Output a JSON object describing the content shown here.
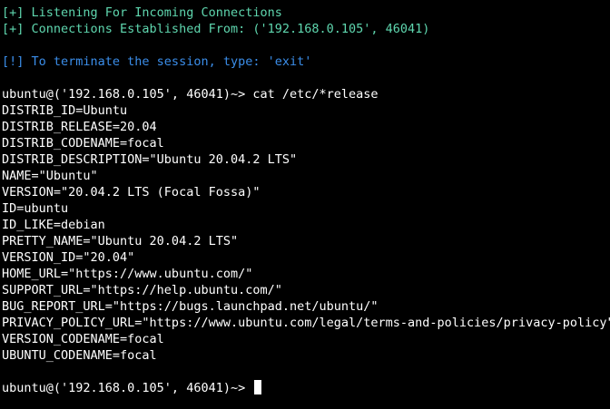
{
  "terminal": {
    "status_lines": [
      "[+] Listening For Incoming Connections",
      "[+] Connections Established From: ('192.168.0.105', 46041)"
    ],
    "info_line": "[!] To terminate the session, type: 'exit'",
    "prompt": "ubuntu@('192.168.0.105', 46041)~> ",
    "command": "cat /etc/*release",
    "output_lines": [
      "DISTRIB_ID=Ubuntu",
      "DISTRIB_RELEASE=20.04",
      "DISTRIB_CODENAME=focal",
      "DISTRIB_DESCRIPTION=\"Ubuntu 20.04.2 LTS\"",
      "NAME=\"Ubuntu\"",
      "VERSION=\"20.04.2 LTS (Focal Fossa)\"",
      "ID=ubuntu",
      "ID_LIKE=debian",
      "PRETTY_NAME=\"Ubuntu 20.04.2 LTS\"",
      "VERSION_ID=\"20.04\"",
      "HOME_URL=\"https://www.ubuntu.com/\"",
      "SUPPORT_URL=\"https://help.ubuntu.com/\"",
      "BUG_REPORT_URL=\"https://bugs.launchpad.net/ubuntu/\"",
      "PRIVACY_POLICY_URL=\"https://www.ubuntu.com/legal/terms-and-policies/privacy-policy\"",
      "VERSION_CODENAME=focal",
      "UBUNTU_CODENAME=focal"
    ],
    "current_prompt": "ubuntu@('192.168.0.105', 46041)~> ",
    "colors": {
      "background": "#000000",
      "status": "#5fd7af",
      "info": "#3b8eea",
      "text": "#ffffff"
    }
  }
}
